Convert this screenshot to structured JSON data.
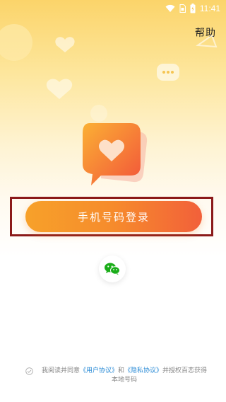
{
  "status_bar": {
    "time": "11:41"
  },
  "header": {
    "help_label": "帮助"
  },
  "login": {
    "phone_button_label": "手机号码登录"
  },
  "agreement": {
    "prefix": "我阅读并同意",
    "user_agreement": "《用户协议》",
    "and": "和",
    "privacy_policy": "《隐私协议》",
    "suffix": "并授权百恋获得本地号码"
  },
  "colors": {
    "accent_orange": "#f68b2c",
    "link_blue": "#2a8bd6",
    "wechat_green": "#1aad19",
    "frame_red": "#8b1a1a"
  }
}
